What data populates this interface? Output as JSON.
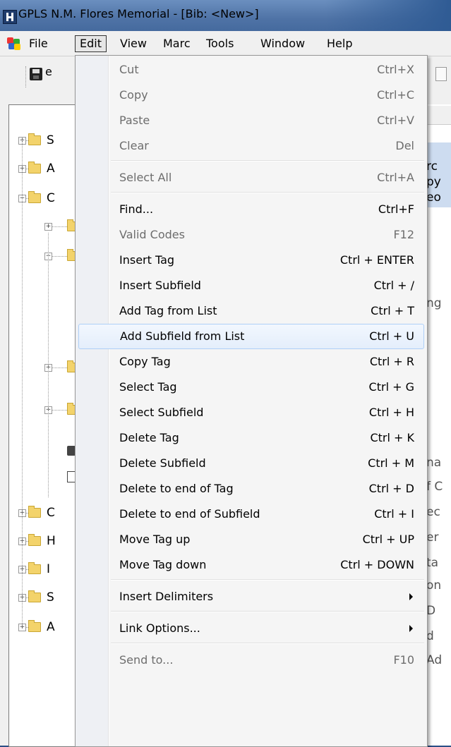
{
  "window": {
    "title": "GPLS N.M. Flores Memorial - [Bib: <New>]"
  },
  "menubar": {
    "items": [
      {
        "label": "File"
      },
      {
        "label": "Edit"
      },
      {
        "label": "View"
      },
      {
        "label": "Marc"
      },
      {
        "label": "Tools"
      },
      {
        "label": "Window"
      },
      {
        "label": "Help"
      }
    ]
  },
  "toolbar": {
    "first_label_fragment": "e"
  },
  "tree": {
    "letters": [
      "S",
      "A",
      "C",
      "",
      "",
      "",
      "",
      "",
      "",
      "",
      "C",
      "H",
      "I",
      "S",
      "A"
    ]
  },
  "right_pane": {
    "lines": [
      "rc",
      "py",
      "eo",
      "ng",
      "na",
      "f C",
      "ec",
      "er",
      "ta",
      "on",
      "D",
      "d",
      "Ad"
    ]
  },
  "edit_menu": {
    "items": [
      {
        "label": "Cut",
        "shortcut": "Ctrl+X",
        "enabled": false
      },
      {
        "label": "Copy",
        "shortcut": "Ctrl+C",
        "enabled": false
      },
      {
        "label": "Paste",
        "shortcut": "Ctrl+V",
        "enabled": false
      },
      {
        "label": "Clear",
        "shortcut": "Del",
        "enabled": false
      },
      {
        "label": "Select All",
        "shortcut": "Ctrl+A",
        "enabled": false
      },
      {
        "label": "Find...",
        "shortcut": "Ctrl+F",
        "enabled": true
      },
      {
        "label": "Valid Codes",
        "shortcut": "F12",
        "enabled": false
      },
      {
        "label": "Insert Tag",
        "shortcut": "Ctrl + ENTER",
        "enabled": true
      },
      {
        "label": "Insert Subfield",
        "shortcut": "Ctrl + /",
        "enabled": true
      },
      {
        "label": "Add Tag from List",
        "shortcut": "Ctrl + T",
        "enabled": true
      },
      {
        "label": "Add Subfield from List",
        "shortcut": "Ctrl + U",
        "enabled": true,
        "highlighted": true
      },
      {
        "label": "Copy Tag",
        "shortcut": "Ctrl + R",
        "enabled": true
      },
      {
        "label": "Select Tag",
        "shortcut": "Ctrl + G",
        "enabled": true
      },
      {
        "label": "Select Subfield",
        "shortcut": "Ctrl + H",
        "enabled": true
      },
      {
        "label": "Delete Tag",
        "shortcut": "Ctrl + K",
        "enabled": true
      },
      {
        "label": "Delete Subfield",
        "shortcut": "Ctrl + M",
        "enabled": true
      },
      {
        "label": "Delete to end of Tag",
        "shortcut": "Ctrl + D",
        "enabled": true
      },
      {
        "label": "Delete to end of Subfield",
        "shortcut": "Ctrl + I",
        "enabled": true
      },
      {
        "label": "Move Tag up",
        "shortcut": "Ctrl + UP",
        "enabled": true
      },
      {
        "label": "Move Tag down",
        "shortcut": "Ctrl + DOWN",
        "enabled": true
      },
      {
        "label": "Insert Delimiters",
        "shortcut": "",
        "enabled": true,
        "submenu": true
      },
      {
        "label": "Link Options...",
        "shortcut": "",
        "enabled": true,
        "submenu": true
      },
      {
        "label": "Send to...",
        "shortcut": "F10",
        "enabled": false
      }
    ]
  },
  "colors": {
    "desktop": "#2b4f86",
    "menu_highlight_border": "#aecff7",
    "disabled_text": "#6d6d6d"
  }
}
